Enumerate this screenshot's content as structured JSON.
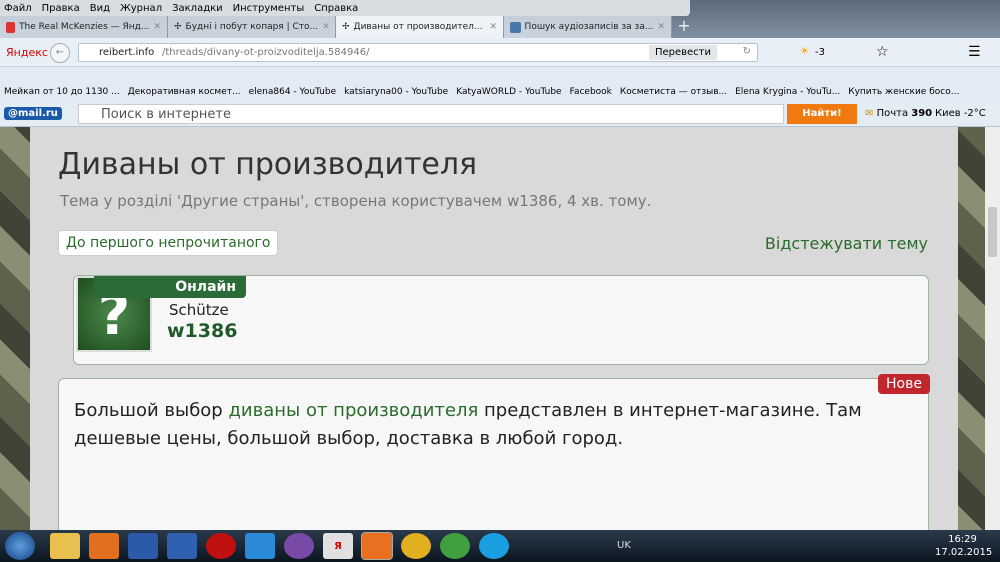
{
  "menu": [
    "Файл",
    "Правка",
    "Вид",
    "Журнал",
    "Закладки",
    "Инструменты",
    "Справка"
  ],
  "tabs": [
    {
      "label": "The Real McKenzies — Янд..."
    },
    {
      "label": "Будні і побут копаря | Сто..."
    },
    {
      "label": "Диваны от производител..."
    },
    {
      "label": "Пошук аудіозаписів за за..."
    }
  ],
  "nav": {
    "brand": "Яндекс",
    "url_host": "reibert.info",
    "url_path": "/threads/divany-ot-proizvoditelja.584946/",
    "translate": "Перевести",
    "weather": "-3"
  },
  "bookmarks": [
    "Мейкап от 10 до 1130 ...",
    "Декоративная космет...",
    "elena864 - YouTube",
    "katsiaryna00 - YouTube",
    "KatyaWORLD - YouTube",
    "Facebook",
    "Косметиста — отзыв...",
    "Elena Krygina - YouTu...",
    "Купить женские босо..."
  ],
  "mailbar": {
    "logo": "@mail.ru",
    "search_placeholder": "Поиск в интернете",
    "search_button": "Найти!",
    "mail_label": "Почта",
    "mail_count": "390",
    "weather": "Киев -2°C"
  },
  "thread": {
    "title": "Диваны от производителя",
    "subtitle": "Тема у розділі 'Другие страны', створена користувачем w1386, 4 хв. тому.",
    "unread_button": "До першого непрочитаного",
    "watch_link": "Відстежувати тему"
  },
  "author": {
    "status": "Онлайн",
    "rank": "Schütze",
    "name": "w1386"
  },
  "post": {
    "badge": "Нове",
    "text_before": "Большой выбор ",
    "link": "диваны от производителя",
    "text_after": " представлен в интернет-магазине. Там дешевые цены, большой выбор, доставка в любой город."
  },
  "taskbar": {
    "lang": "UK",
    "time": "16:29",
    "date": "17.02.2015"
  }
}
